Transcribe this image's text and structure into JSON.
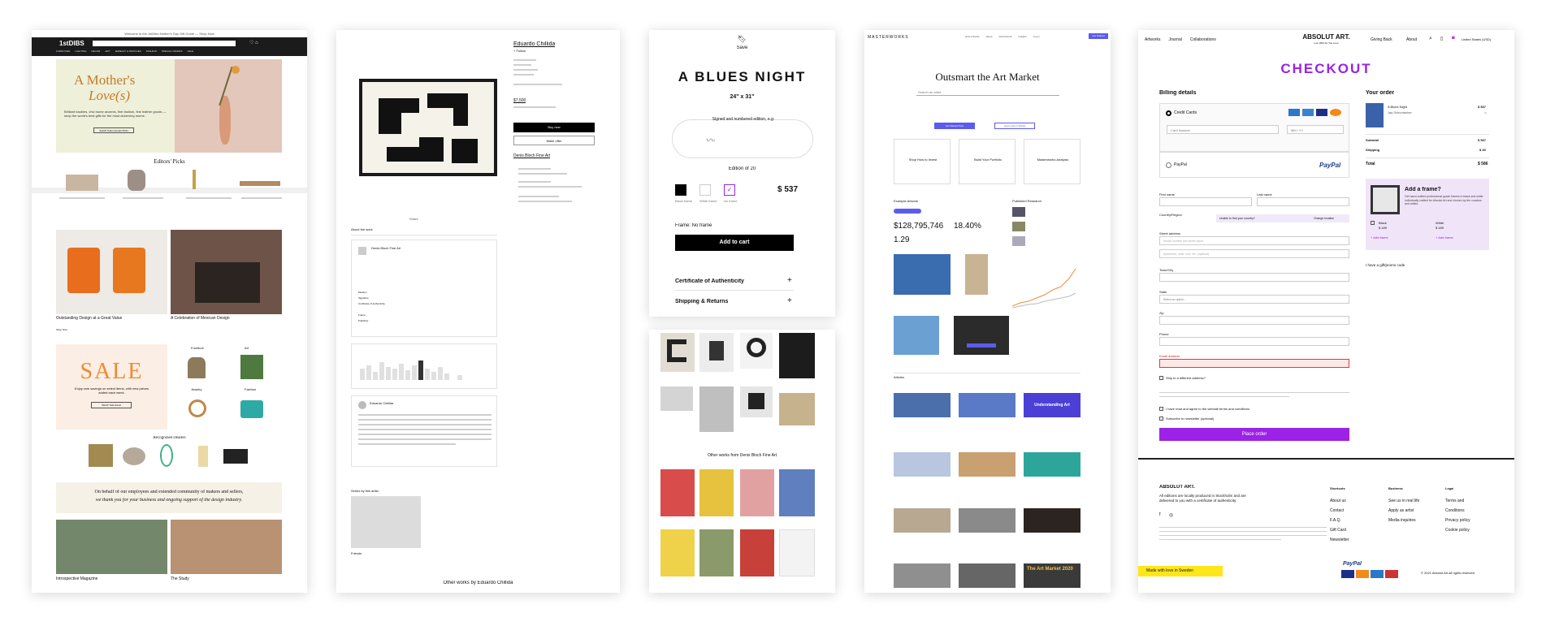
{
  "p1": {
    "promo": "Welcome to the 1stDibs Mother's Day Gift Guide — Shop Now",
    "logo": "1stDIBS",
    "nav": [
      "FURNITURE",
      "LIGHTING",
      "DECOR",
      "ART",
      "JEWELRY & WATCHES",
      "FASHION",
      "SPECIAL OFFERS",
      "SALE"
    ],
    "hero_title_1": "A Mother's",
    "hero_title_2": "Love(s)",
    "hero_text": "Brilliant baubles, chic home accents, fine fashion, fine leather goods — shop the world's best gifts for the most deserving moms.",
    "hero_btn": "SHOP THE COLLECTION",
    "editors": "Editors' Picks",
    "feat1": "Outstanding Design at a Great Value",
    "feat2": "A Celebration of Mexican Design",
    "shop_now": "Shop Now",
    "sale": "SALE",
    "sale_text": "Enjoy rare savings on select items, with new pieces added each week.",
    "sale_btn": "SHOP THE SALE",
    "cat1": "Furniture",
    "cat2": "Art",
    "cat3": "Jewelry",
    "cat4": "Fashion",
    "recognized": "Recognized Dealers",
    "behalf_1": "On behalf of our employees and extended community of makers and sellers,",
    "behalf_2": "we thank you for your business and ongoing support of the design industry.",
    "bottom1": "Introspective Magazine",
    "bottom2": "The Study"
  },
  "p2": {
    "artist": "Eduardo Chillida",
    "follow": "+ Follow",
    "price": "$7,500",
    "buy": "Buy now",
    "offer": "Make offer",
    "dealer": "Denis Bloch Fine Art",
    "share": "Share",
    "about": "About the work",
    "title": "Denis Bloch Fine Art",
    "medium": "Medium",
    "signature": "Signature",
    "cert": "Certificate of authenticity",
    "frame": "Frame",
    "publisher": "Publisher",
    "bio_name": "Eduardo Chillida",
    "series": "Series by this artist",
    "series_item": "Friends",
    "other": "Other works by Eduardo Chillida",
    "view_all": "View all"
  },
  "p3": {
    "save": "Save",
    "title": "A BLUES NIGHT",
    "size": "24\" x 31\"",
    "signed": "Signed and numbered edition, e.g:",
    "edition": "Edition of 20",
    "frame_black": "Black frame",
    "frame_white": "White frame",
    "frame_none": "No frame",
    "price": "$ 537",
    "frame_label": "Frame: No frame",
    "add": "Add to cart",
    "cert": "Certificate of Authenticity",
    "shipping": "Shipping & Returns",
    "other": "Other works from Denis Bloch Fine Art"
  },
  "p4": {
    "logo": "MASTERWORKS",
    "nav": [
      "How it Works",
      "About",
      "Sell Artwork",
      "Insights",
      "Log in"
    ],
    "get_started": "Get Started",
    "hero": "Outsmart the Art Market",
    "search": "Search an artist",
    "btn1": "Get Started Now",
    "btn2": "Learn How It Works",
    "card1": "Shop How to Invest",
    "card2": "Build Your Portfolio",
    "card3": "Masterworks Analysis",
    "examples": "Example Artwork",
    "stat1": "$128,795,746",
    "stat2": "18.40%",
    "stat3": "1.29",
    "pub": "Published Research",
    "articles": "Articles",
    "art_box": "Understanding Art",
    "market": "The Art Market 2020"
  },
  "p5": {
    "nav": [
      "Artworks",
      "Journal",
      "Collaborations"
    ],
    "logo": "ABSOLUT ART.",
    "tagline": "Live With Art You Love",
    "right_nav": [
      "Giving Back",
      "About"
    ],
    "region": "United States (USD)",
    "checkout": "CHECKOUT",
    "billing": "Billing details",
    "credit": "Credit Cards",
    "card_number": "Card Number",
    "mmyy": "MM / YY",
    "paypal": "PayPal",
    "first": "First name",
    "last": "Last name",
    "country": "Country/Region",
    "unable": "Unable to find your country?",
    "change": "Change location",
    "street": "Street address",
    "street_ph": "House number and street name",
    "apt_ph": "Apartment, suite, unit, etc. (optional)",
    "town": "Town/City",
    "state": "State",
    "state_ph": "Select an option...",
    "zip": "Zip",
    "phone": "Phone",
    "email": "Email address",
    "ship_diff": "Ship to a different address?",
    "terms": "I have read and agree to the website terms and conditions",
    "subscribe": "Subscribe to newsletter (optional)",
    "place": "Place order",
    "your_order": "Your order",
    "item": "A Blues Night",
    "item_artist": "Jay Schumacher",
    "item_price": "$ 537",
    "subtotal": "Subtotal",
    "subtotal_v": "$ 537",
    "shipping": "Shipping",
    "shipping_v": "$ 49",
    "total": "Total",
    "total_v": "$ 586",
    "frame_q": "Add a frame?",
    "frame_txt": "Get hand-crafted professional grade frames in black and white individually crafted for Absolut Art and chosen by the curators and artists.",
    "black": "Black",
    "white": "White",
    "black_p": "$ 189",
    "white_p": "$ 189",
    "add_frame": "+ Add frame",
    "promo": "I have a gift/promo code",
    "f_logo": "ABSOLUT ART.",
    "f_text": "All editions are locally produced in Stockholm and are delivered to you with a certificate of authenticity.",
    "f_head1": "Shortcuts",
    "f_links1": [
      "About us",
      "Contact",
      "F.A.Q.",
      "Gift Card",
      "Newsletter"
    ],
    "f_head2": "Business",
    "f_links2": [
      "See us in real life",
      "Apply as artist",
      "Media inquiries"
    ],
    "f_head3": "Legal",
    "f_links3": [
      "Terms and",
      "Conditions",
      "Privacy policy",
      "Cookie policy"
    ],
    "sweden": "Made with love in Sweden",
    "copyright": "© 2021 Absolut Art all rights reserved"
  },
  "colors": {
    "purple": "#9b22e6",
    "masterworks": "#5b5bf0",
    "sweden_yellow": "#ffe619",
    "ghost": "#f4f4f4"
  }
}
